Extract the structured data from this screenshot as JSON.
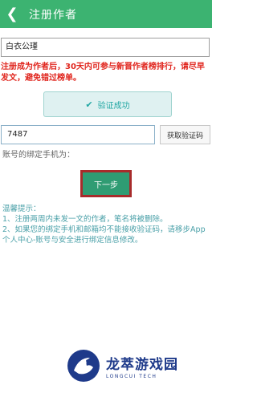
{
  "header": {
    "back_icon": "chevron-left-icon",
    "title": "注册作者",
    "background": "#3cb371"
  },
  "form": {
    "pen_name_value": "白衣公瑾",
    "notice": "注册成为作者后，30天内可参与新晋作者榜排行，请尽早发文，避免错过榜单。",
    "verified_label": "验证成功",
    "code_value": "7487",
    "get_code_label": "获取验证码",
    "bound_phone_label": "账号的绑定手机为：",
    "next_button_label": "下一步"
  },
  "tips": {
    "heading": "温馨提示：",
    "items": [
      "1、注册两周内未发一文的作者，笔名将被删除。",
      "2、如果您的绑定手机和邮箱均不能接收验证码，请移步App个人中心-账号与安全进行绑定信息修改。"
    ]
  },
  "watermark": {
    "title": "龙萃游戏园",
    "subtitle": "LONGCUI TECH"
  }
}
